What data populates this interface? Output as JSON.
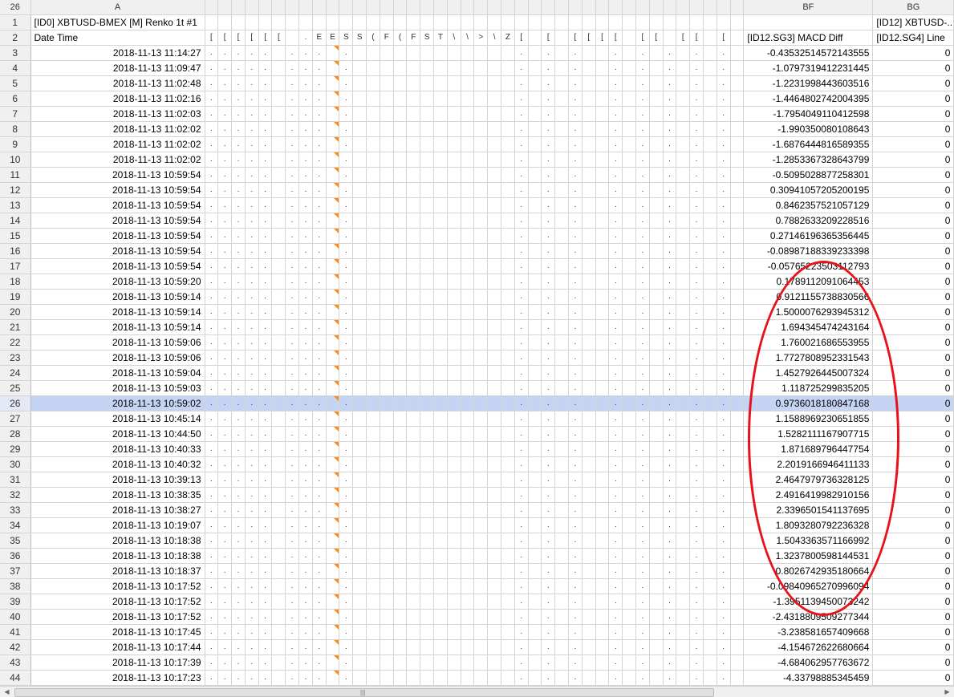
{
  "name_box": "26",
  "columns": {
    "a": "A",
    "bf": "BF",
    "bg": "BG"
  },
  "row1": {
    "num": "1",
    "a": "[ID0] XBTUSD-BMEX [M]  Renko 1t  #1",
    "bf": "",
    "bg": "[ID12] XBTUSD-..."
  },
  "row2": {
    "num": "2",
    "a": "Date Time",
    "bf": "[ID12.SG3] MACD Diff",
    "bg": "[ID12.SG4] Line"
  },
  "data_rows": [
    {
      "num": "3",
      "a": "2018-11-13  11:14:27",
      "bf": "-0.43532514572143555",
      "bg": "0"
    },
    {
      "num": "4",
      "a": "2018-11-13  11:09:47",
      "bf": "-1.0797319412231445",
      "bg": "0"
    },
    {
      "num": "5",
      "a": "2018-11-13  11:02:48",
      "bf": "-1.2231998443603516",
      "bg": "0"
    },
    {
      "num": "6",
      "a": "2018-11-13  11:02:16",
      "bf": "-1.4464802742004395",
      "bg": "0"
    },
    {
      "num": "7",
      "a": "2018-11-13  11:02:03",
      "bf": "-1.7954049110412598",
      "bg": "0"
    },
    {
      "num": "8",
      "a": "2018-11-13  11:02:02",
      "bf": "-1.990350080108643",
      "bg": "0"
    },
    {
      "num": "9",
      "a": "2018-11-13  11:02:02",
      "bf": "-1.6876444816589355",
      "bg": "0"
    },
    {
      "num": "10",
      "a": "2018-11-13  11:02:02",
      "bf": "-1.2853367328643799",
      "bg": "0"
    },
    {
      "num": "11",
      "a": "2018-11-13  10:59:54",
      "bf": "-0.5095028877258301",
      "bg": "0"
    },
    {
      "num": "12",
      "a": "2018-11-13  10:59:54",
      "bf": "0.30941057205200195",
      "bg": "0"
    },
    {
      "num": "13",
      "a": "2018-11-13  10:59:54",
      "bf": "0.8462357521057129",
      "bg": "0"
    },
    {
      "num": "14",
      "a": "2018-11-13  10:59:54",
      "bf": "0.7882633209228516",
      "bg": "0"
    },
    {
      "num": "15",
      "a": "2018-11-13  10:59:54",
      "bf": "0.27146196365356445",
      "bg": "0"
    },
    {
      "num": "16",
      "a": "2018-11-13  10:59:54",
      "bf": "-0.08987188339233398",
      "bg": "0"
    },
    {
      "num": "17",
      "a": "2018-11-13  10:59:54",
      "bf": "-0.05765223503112793",
      "bg": "0"
    },
    {
      "num": "18",
      "a": "2018-11-13  10:59:20",
      "bf": "0.1789112091064453",
      "bg": "0"
    },
    {
      "num": "19",
      "a": "2018-11-13  10:59:14",
      "bf": "0.9121155738830566",
      "bg": "0"
    },
    {
      "num": "20",
      "a": "2018-11-13  10:59:14",
      "bf": "1.5000076293945312",
      "bg": "0"
    },
    {
      "num": "21",
      "a": "2018-11-13  10:59:14",
      "bf": "1.694345474243164",
      "bg": "0"
    },
    {
      "num": "22",
      "a": "2018-11-13  10:59:06",
      "bf": "1.760021686553955",
      "bg": "0"
    },
    {
      "num": "23",
      "a": "2018-11-13  10:59:06",
      "bf": "1.7727808952331543",
      "bg": "0"
    },
    {
      "num": "24",
      "a": "2018-11-13  10:59:04",
      "bf": "1.4527926445007324",
      "bg": "0"
    },
    {
      "num": "25",
      "a": "2018-11-13  10:59:03",
      "bf": "1.118725299835205",
      "bg": "0"
    },
    {
      "num": "26",
      "a": "2018-11-13  10:59:02",
      "bf": "0.9736018180847168",
      "bg": "0",
      "selected": true
    },
    {
      "num": "27",
      "a": "2018-11-13  10:45:14",
      "bf": "1.1588969230651855",
      "bg": "0"
    },
    {
      "num": "28",
      "a": "2018-11-13  10:44:50",
      "bf": "1.5282111167907715",
      "bg": "0"
    },
    {
      "num": "29",
      "a": "2018-11-13  10:40:33",
      "bf": "1.871689796447754",
      "bg": "0"
    },
    {
      "num": "30",
      "a": "2018-11-13  10:40:32",
      "bf": "2.2019166946411133",
      "bg": "0"
    },
    {
      "num": "31",
      "a": "2018-11-13  10:39:13",
      "bf": "2.4647979736328125",
      "bg": "0"
    },
    {
      "num": "32",
      "a": "2018-11-13  10:38:35",
      "bf": "2.4916419982910156",
      "bg": "0"
    },
    {
      "num": "33",
      "a": "2018-11-13  10:38:27",
      "bf": "2.3396501541137695",
      "bg": "0"
    },
    {
      "num": "34",
      "a": "2018-11-13  10:19:07",
      "bf": "1.8093280792236328",
      "bg": "0"
    },
    {
      "num": "35",
      "a": "2018-11-13  10:18:38",
      "bf": "1.5043363571166992",
      "bg": "0"
    },
    {
      "num": "36",
      "a": "2018-11-13  10:18:38",
      "bf": "1.3237800598144531",
      "bg": "0"
    },
    {
      "num": "37",
      "a": "2018-11-13  10:18:37",
      "bf": "0.8026742935180664",
      "bg": "0"
    },
    {
      "num": "38",
      "a": "2018-11-13  10:17:52",
      "bf": "-0.09840965270996094",
      "bg": "0"
    },
    {
      "num": "39",
      "a": "2018-11-13  10:17:52",
      "bf": "-1.3951139450073242",
      "bg": "0"
    },
    {
      "num": "40",
      "a": "2018-11-13  10:17:52",
      "bf": "-2.4318809509277344",
      "bg": "0"
    },
    {
      "num": "41",
      "a": "2018-11-13  10:17:45",
      "bf": "-3.238581657409668",
      "bg": "0"
    },
    {
      "num": "42",
      "a": "2018-11-13  10:17:44",
      "bf": "-4.154672622680664",
      "bg": "0"
    },
    {
      "num": "43",
      "a": "2018-11-13  10:17:39",
      "bf": "-4.684062957763672",
      "bg": "0"
    },
    {
      "num": "44",
      "a": "2018-11-13  10:17:23",
      "bf": "-4.33798885345459",
      "bg": "0"
    }
  ],
  "colors": {
    "selection": "#c6d4f4",
    "annotation_oval": "#e8131a",
    "comment_marker": "#ff8c1a"
  },
  "icons": {
    "scroll_left": "scroll-left-arrow-icon",
    "scroll_right": "scroll-right-arrow-icon",
    "grip": "scroll-grip-icon"
  }
}
